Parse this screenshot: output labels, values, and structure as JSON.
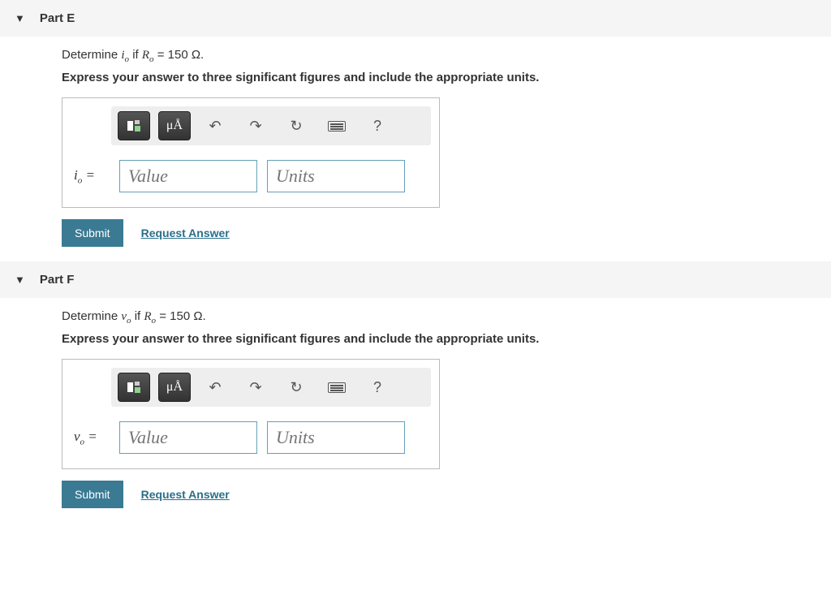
{
  "parts": [
    {
      "header": "Part E",
      "prompt_prefix": "Determine ",
      "var_letter": "i",
      "var_sub": "o",
      "prompt_mid": " if ",
      "cond_var": "R",
      "cond_sub": "o",
      "cond_val": " = 150 Ω.",
      "instruction": "Express your answer to three significant figures and include the appropriate units.",
      "lhs_letter": "i",
      "lhs_sub": "o",
      "lhs_eq": " =",
      "value_placeholder": "Value",
      "units_placeholder": "Units",
      "submit": "Submit",
      "request": "Request Answer"
    },
    {
      "header": "Part F",
      "prompt_prefix": "Determine ",
      "var_letter": "v",
      "var_sub": "o",
      "prompt_mid": " if ",
      "cond_var": "R",
      "cond_sub": "o",
      "cond_val": " = 150 Ω.",
      "instruction": "Express your answer to three significant figures and include the appropriate units.",
      "lhs_letter": "v",
      "lhs_sub": "o",
      "lhs_eq": " =",
      "value_placeholder": "Value",
      "units_placeholder": "Units",
      "submit": "Submit",
      "request": "Request Answer"
    }
  ],
  "toolbar": {
    "mu_label": "μÅ",
    "help": "?"
  }
}
